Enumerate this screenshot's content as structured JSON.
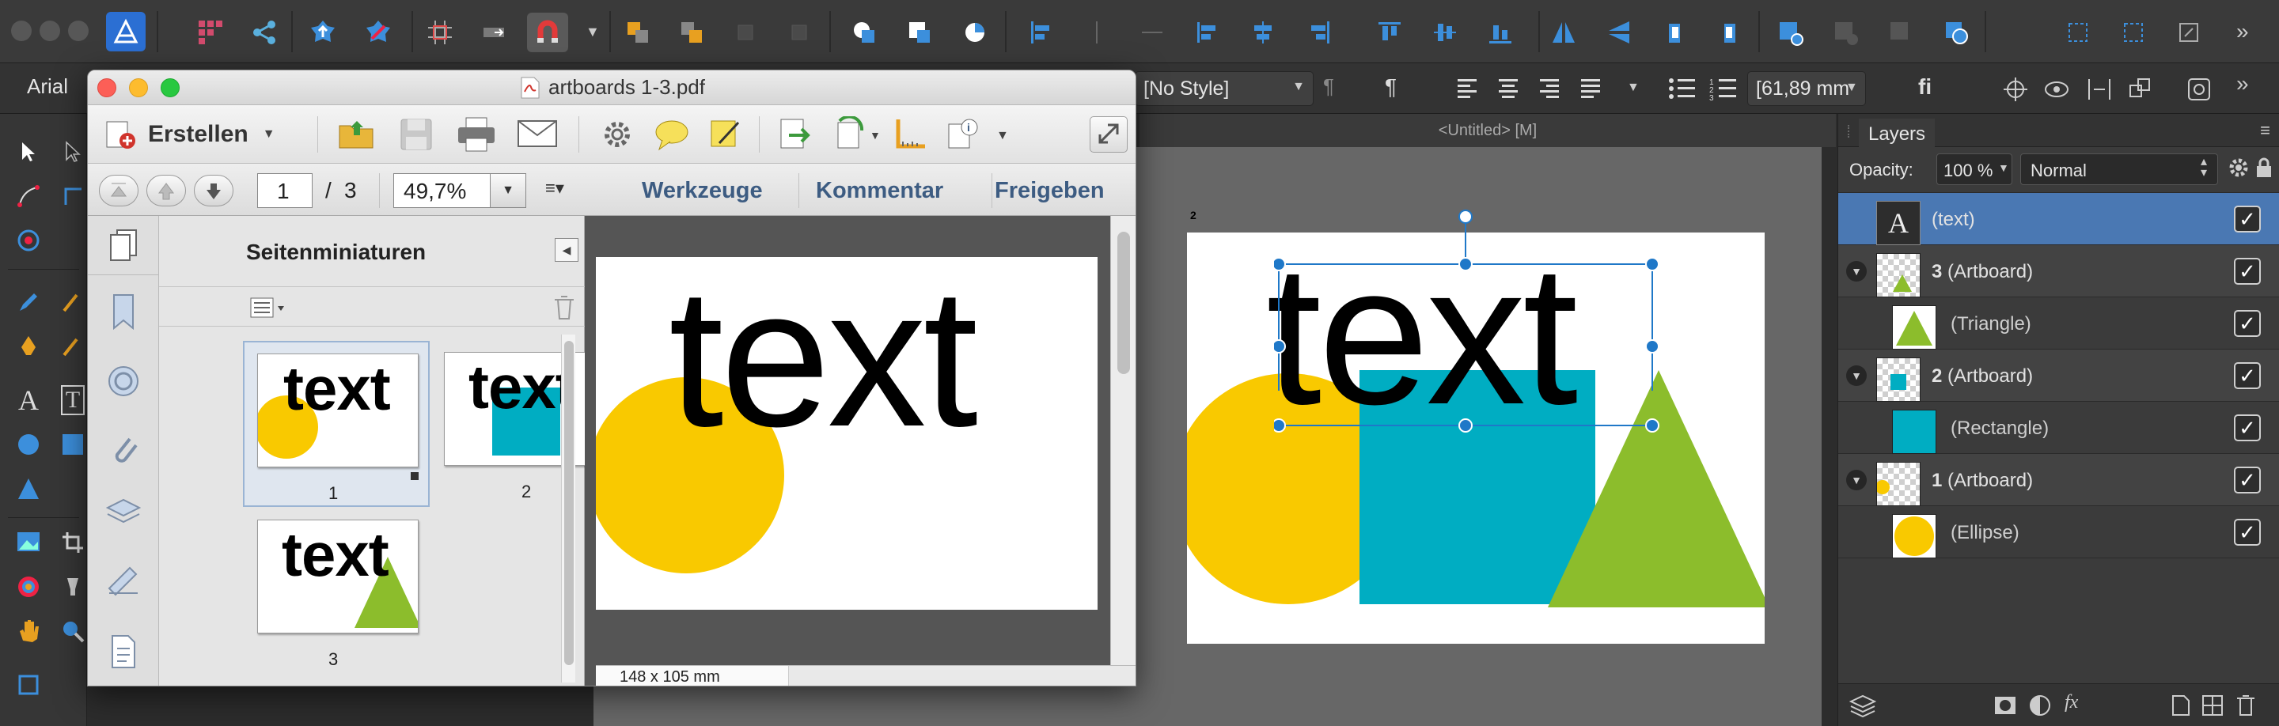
{
  "app": {
    "font_family_field": "Arial",
    "style_field": "[No Style]",
    "size_field": "[61,89 mm",
    "ligature_button": "fi",
    "document_tab_title": "<Untitled> [M]",
    "artboard_label": "2"
  },
  "colors": {
    "yellow": "#f9c900",
    "teal": "#00adc2",
    "green": "#8cbd2c",
    "selection": "#1f78c8",
    "layer_selected": "#4a78b3"
  },
  "layers_panel": {
    "title": "Layers",
    "opacity_label": "Opacity:",
    "opacity_value": "100 %",
    "blend_mode": "Normal",
    "rows": [
      {
        "name": "(text)",
        "bold": "",
        "indent": false,
        "selected": true
      },
      {
        "name": " (Artboard)",
        "bold": "3",
        "indent": false,
        "selected": false
      },
      {
        "name": "(Triangle)",
        "bold": "",
        "indent": true,
        "selected": false
      },
      {
        "name": " (Artboard)",
        "bold": "2",
        "indent": false,
        "selected": false
      },
      {
        "name": "(Rectangle)",
        "bold": "",
        "indent": true,
        "selected": false
      },
      {
        "name": " (Artboard)",
        "bold": "1",
        "indent": false,
        "selected": false
      },
      {
        "name": "(Ellipse)",
        "bold": "",
        "indent": true,
        "selected": false
      }
    ],
    "check_glyph": "✓",
    "fx_label": "fx"
  },
  "canvas": {
    "text": "text"
  },
  "acrobat": {
    "title": "artboards 1-3.pdf",
    "create_button": "Erstellen",
    "page_current": "1",
    "page_separator": "/",
    "page_total": "3",
    "zoom": "49,7%",
    "nav_tools": "Werkzeuge",
    "nav_comment": "Kommentar",
    "nav_share": "Freigeben",
    "sidebar_title": "Seitenminiaturen",
    "thumbnails": [
      {
        "label": "1",
        "text": "text"
      },
      {
        "label": "2",
        "text": "text"
      },
      {
        "label": "3",
        "text": "text"
      }
    ],
    "page_text": "text",
    "page_size": "148 x 105 mm"
  }
}
